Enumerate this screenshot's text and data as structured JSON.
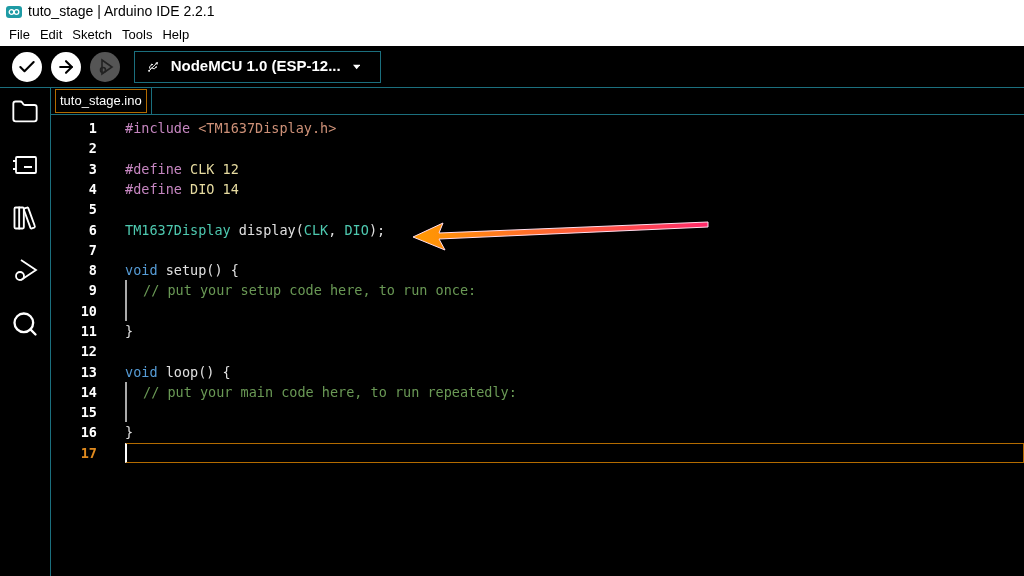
{
  "window": {
    "title": "tuto_stage | Arduino IDE 2.2.1"
  },
  "menu": [
    "File",
    "Edit",
    "Sketch",
    "Tools",
    "Help"
  ],
  "toolbar": {
    "debug_disabled": true,
    "board": "NodeMCU 1.0 (ESP-12..."
  },
  "tabs": [
    {
      "label": "tuto_stage.ino",
      "selected": true
    }
  ],
  "editor": {
    "lines": [
      {
        "number": "1",
        "current": false,
        "guide": false,
        "tokens": [
          {
            "kind": "directive",
            "text": "#include "
          },
          {
            "kind": "header",
            "text": "<TM1637Display.h>"
          }
        ]
      },
      {
        "number": "2",
        "current": false,
        "guide": false
      },
      {
        "number": "3",
        "current": false,
        "guide": false,
        "tokens": [
          {
            "kind": "directive",
            "text": "#define "
          },
          {
            "kind": "macro",
            "text": "CLK 12"
          }
        ]
      },
      {
        "number": "4",
        "current": false,
        "guide": false,
        "tokens": [
          {
            "kind": "directive",
            "text": "#define "
          },
          {
            "kind": "macro",
            "text": "DIO 14"
          }
        ]
      },
      {
        "number": "5",
        "current": false,
        "guide": false
      },
      {
        "number": "6",
        "current": false,
        "guide": false,
        "tokens": [
          {
            "kind": "type",
            "text": "TM1637Display "
          },
          {
            "kind": "plain",
            "text": "display("
          },
          {
            "kind": "type",
            "text": "CLK"
          },
          {
            "kind": "plain",
            "text": ", "
          },
          {
            "kind": "type",
            "text": "DIO"
          },
          {
            "kind": "plain",
            "text": ");"
          }
        ]
      },
      {
        "number": "7",
        "current": false,
        "guide": false
      },
      {
        "number": "8",
        "current": false,
        "guide": false,
        "tokens": [
          {
            "kind": "keyword",
            "text": "void "
          },
          {
            "kind": "plain",
            "text": "setup() {"
          }
        ]
      },
      {
        "number": "9",
        "current": false,
        "guide": true,
        "tokens": [
          {
            "kind": "comment",
            "text": "// put your setup code here, to run once:"
          }
        ]
      },
      {
        "number": "10",
        "current": false,
        "guide": true
      },
      {
        "number": "11",
        "current": false,
        "guide": false,
        "tokens": [
          {
            "kind": "plain",
            "text": "}"
          }
        ]
      },
      {
        "number": "12",
        "current": false,
        "guide": false
      },
      {
        "number": "13",
        "current": false,
        "guide": false,
        "tokens": [
          {
            "kind": "keyword",
            "text": "void "
          },
          {
            "kind": "plain",
            "text": "loop() {"
          }
        ]
      },
      {
        "number": "14",
        "current": false,
        "guide": true,
        "tokens": [
          {
            "kind": "comment",
            "text": "// put your main code here, to run repeatedly:"
          }
        ]
      },
      {
        "number": "15",
        "current": false,
        "guide": true
      },
      {
        "number": "16",
        "current": false,
        "guide": false,
        "tokens": [
          {
            "kind": "plain",
            "text": "}"
          }
        ]
      },
      {
        "number": "17",
        "current": true,
        "guide": false
      }
    ]
  }
}
